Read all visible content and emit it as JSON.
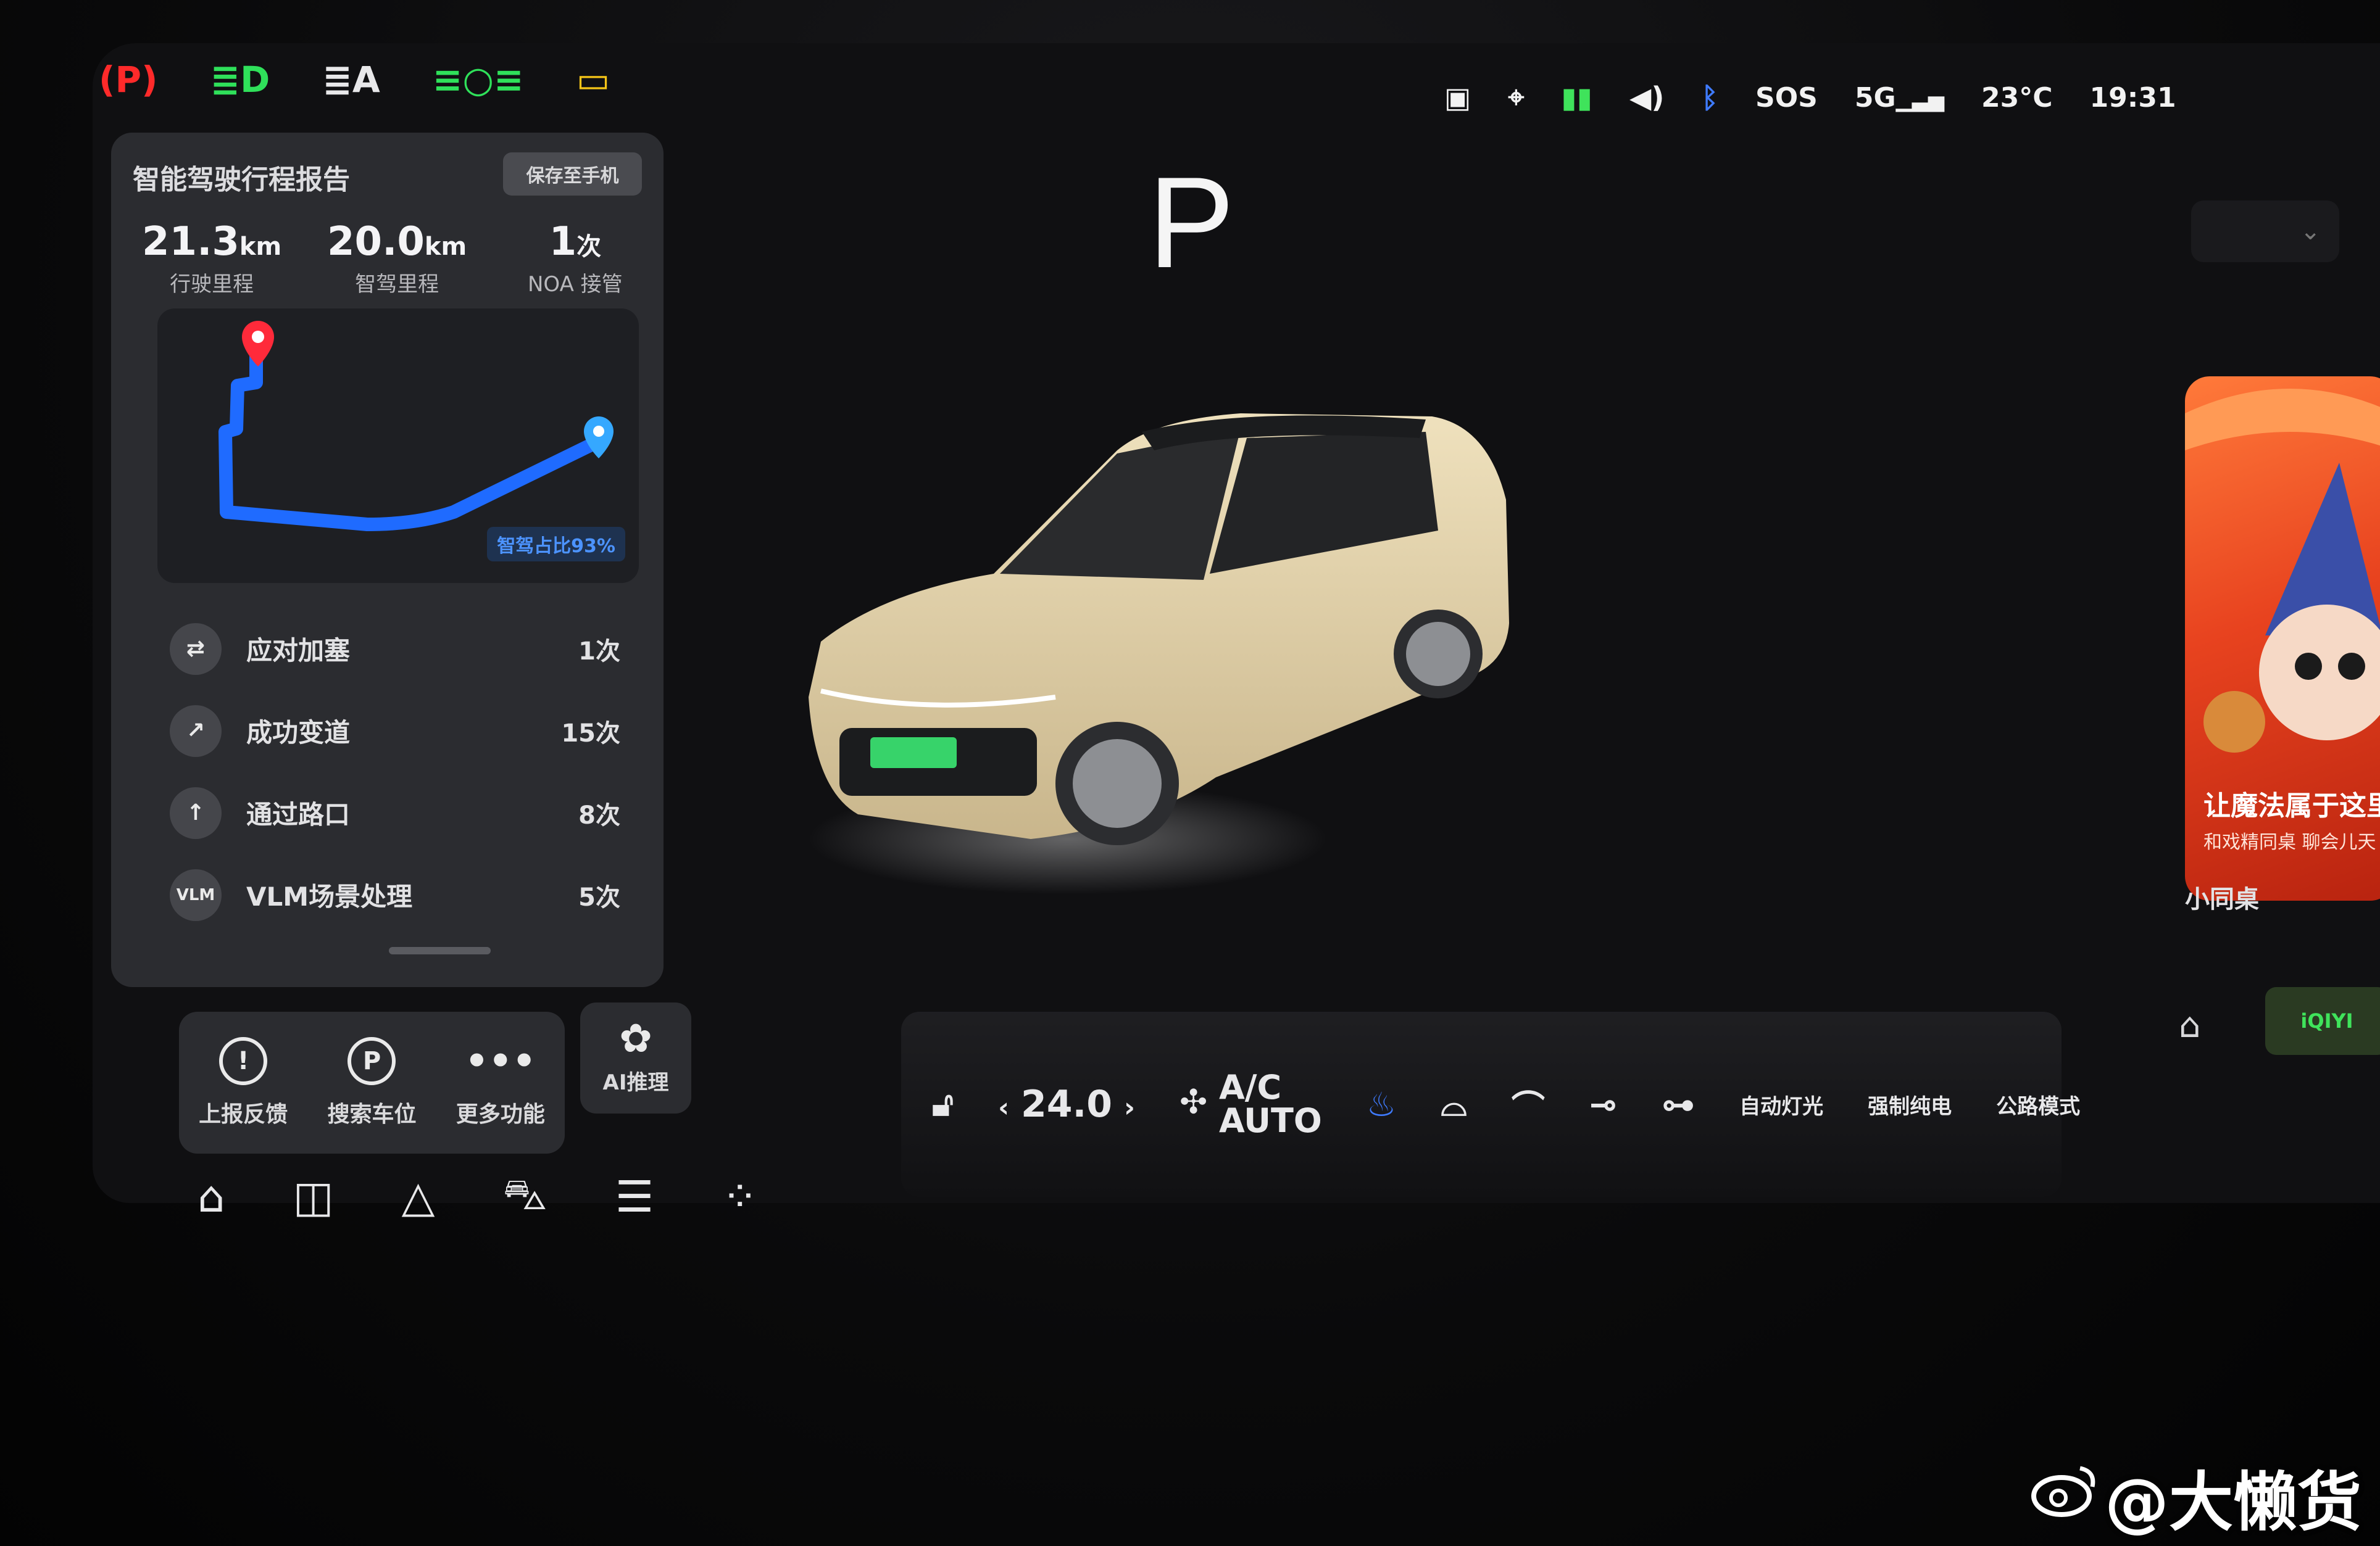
{
  "indicators": [
    {
      "icon": "parking-brake-icon",
      "glyph": "(P)",
      "color": "#ff2a2a"
    },
    {
      "icon": "headlight-icon",
      "glyph": "≣D",
      "color": "#2fe05a"
    },
    {
      "icon": "auto-headlight-icon",
      "glyph": "≣A",
      "color": "#e8e8ea"
    },
    {
      "icon": "position-light-icon",
      "glyph": "≡○≡",
      "color": "#2fe05a"
    },
    {
      "icon": "battery-warning-icon",
      "glyph": "▭",
      "color": "#f5c518"
    }
  ],
  "status_bar": {
    "sos": "SOS",
    "network": "5G",
    "temperature": "23°C",
    "time": "19:31"
  },
  "gear": "P",
  "report": {
    "title": "智能驾驶行程报告",
    "save_label": "保存至手机",
    "stats": [
      {
        "value": "21.3",
        "unit": "km",
        "label": "行驶里程"
      },
      {
        "value": "20.0",
        "unit": "km",
        "label": "智驾里程"
      },
      {
        "value": "1",
        "unit": "次",
        "label": "NOA 接管"
      }
    ],
    "ratio_label": "智驾占比93%",
    "events": [
      {
        "icon": "traffic-cut-in-icon",
        "glyph": "⇄",
        "label": "应对加塞",
        "count": "1次"
      },
      {
        "icon": "lane-change-icon",
        "glyph": "↗",
        "label": "成功变道",
        "count": "15次"
      },
      {
        "icon": "intersection-icon",
        "glyph": "↑",
        "label": "通过路口",
        "count": "8次"
      },
      {
        "icon": "vlm-icon",
        "glyph": "VLM",
        "label": "VLM场景处理",
        "count": "5次"
      }
    ]
  },
  "actions": [
    {
      "icon": "feedback-icon",
      "glyph": "!",
      "label": "上报反馈"
    },
    {
      "icon": "parking-search-icon",
      "glyph": "P",
      "label": "搜索车位"
    },
    {
      "icon": "more-icon",
      "glyph": "•••",
      "label": "更多功能"
    }
  ],
  "ai_button": {
    "label": "AI推理"
  },
  "dock": [
    {
      "icon": "home-icon",
      "glyph": "⌂"
    },
    {
      "icon": "camera-icon",
      "glyph": "◫"
    },
    {
      "icon": "navigation-icon",
      "glyph": "△"
    },
    {
      "icon": "car-icon",
      "glyph": "⛍"
    },
    {
      "icon": "controls-icon",
      "glyph": "☰"
    },
    {
      "icon": "apps-icon",
      "glyph": "⁘"
    }
  ],
  "climate": {
    "temperature": "24.0",
    "ac_label": "A/C",
    "auto_label": "AUTO",
    "auto_light": "自动灯光",
    "forced_ev": "强制纯电",
    "road_mode": "公路模式"
  },
  "right_panel": {
    "promo_title": "让魔法属于这里",
    "promo_subtitle": "和戏精同桌 聊会儿天",
    "app_name": "小同桌",
    "iqiyi": "iQIYI"
  },
  "watermark": "@大懒货"
}
